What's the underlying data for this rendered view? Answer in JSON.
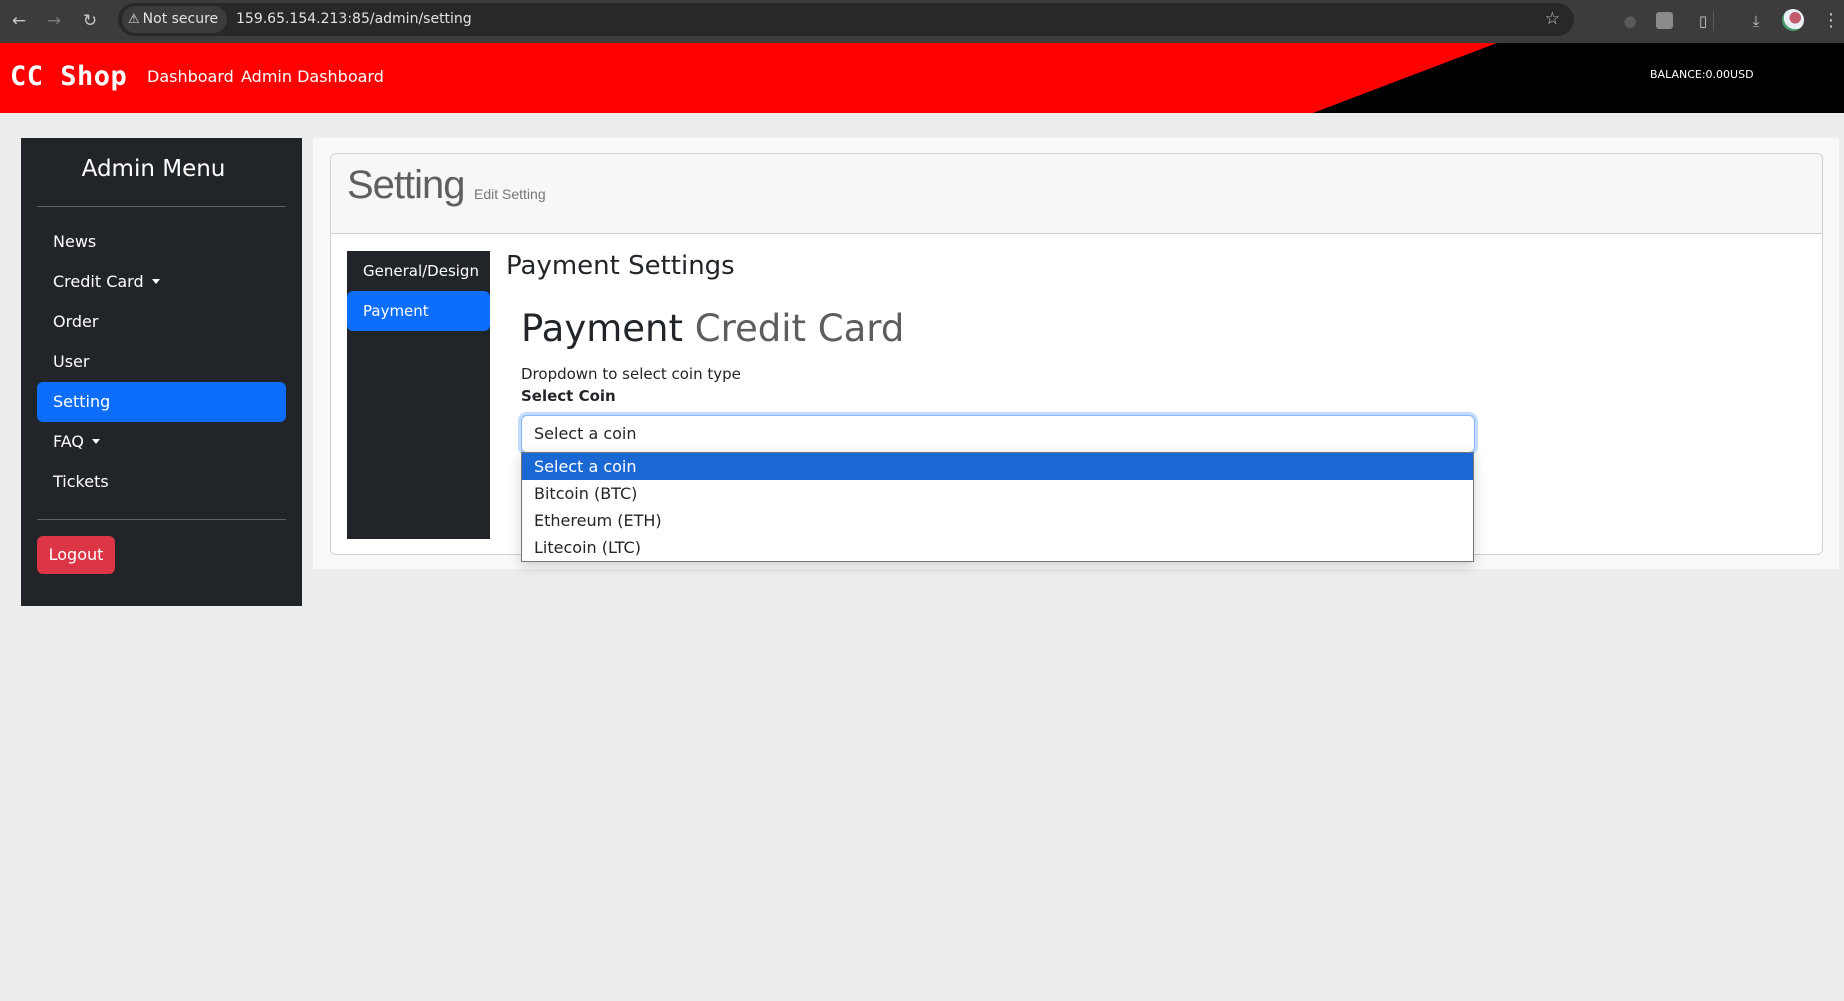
{
  "browser": {
    "security_label": "Not secure",
    "url": "159.65.154.213:85/admin/setting"
  },
  "header": {
    "brand": "CC Shop",
    "links": [
      "Dashboard",
      "Admin Dashboard"
    ],
    "balance": "BALANCE:0.00USD",
    "colors": {
      "primary": "#ff0000",
      "secondary": "#000000"
    }
  },
  "sidebar": {
    "title": "Admin Menu",
    "items": [
      {
        "label": "News",
        "dropdown": false,
        "active": false
      },
      {
        "label": "Credit Card",
        "dropdown": true,
        "active": false
      },
      {
        "label": "Order",
        "dropdown": false,
        "active": false
      },
      {
        "label": "User",
        "dropdown": false,
        "active": false
      },
      {
        "label": "Setting",
        "dropdown": false,
        "active": true
      },
      {
        "label": "FAQ",
        "dropdown": true,
        "active": false
      },
      {
        "label": "Tickets",
        "dropdown": false,
        "active": false
      }
    ],
    "logout_label": "Logout"
  },
  "page": {
    "title": "Setting",
    "subtitle": "Edit Setting",
    "tabs": [
      {
        "label": "General/Design",
        "active": false
      },
      {
        "label": "Payment",
        "active": true
      }
    ],
    "section_title": "Payment Settings",
    "payment_heading": "Payment",
    "payment_heading_muted": "Credit Card",
    "help_text": "Dropdown to select coin type",
    "field_label": "Select Coin",
    "select_value": "Select a coin",
    "options": [
      "Select a coin",
      "Bitcoin (BTC)",
      "Ethereum (ETH)",
      "Litecoin (LTC)"
    ],
    "selected_option_index": 0
  }
}
